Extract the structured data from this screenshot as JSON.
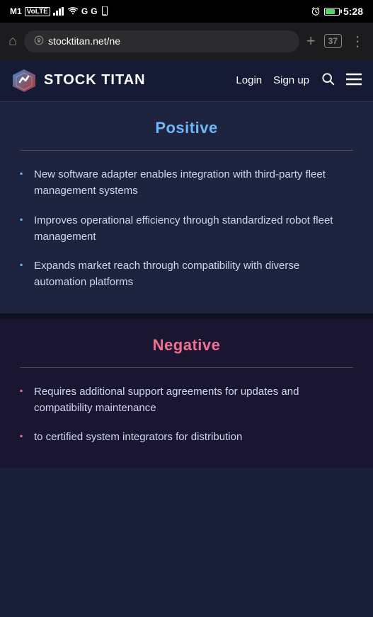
{
  "statusBar": {
    "carrier": "M1",
    "carrierType": "VoLTE",
    "time": "5:28"
  },
  "browserBar": {
    "url": "stocktitan.net/ne",
    "tabCount": "37"
  },
  "nav": {
    "logoText": "STOCK TITAN",
    "loginLabel": "Login",
    "signupLabel": "Sign up"
  },
  "positiveSection": {
    "title": "Positive",
    "items": [
      "New software adapter enables integration with third-party fleet management systems",
      "Improves operational efficiency through standardized robot fleet management",
      "Expands market reach through compatibility with diverse automation platforms"
    ]
  },
  "negativeSection": {
    "title": "Negative",
    "items": [
      "Requires additional support agreements for updates and compatibility maintenance",
      "to certified system integrators for distribution"
    ]
  }
}
